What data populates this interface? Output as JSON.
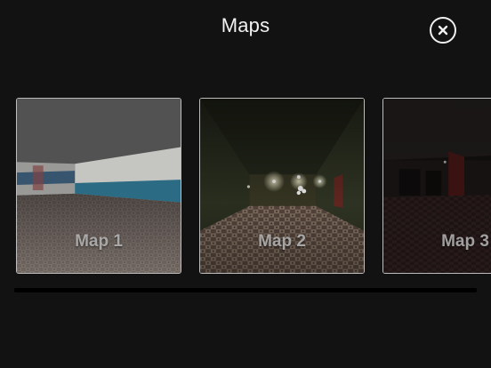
{
  "header": {
    "title": "Maps"
  },
  "close_button": {
    "icon": "close-icon"
  },
  "maps": [
    {
      "label": "Map 1"
    },
    {
      "label": "Map 2"
    },
    {
      "label": "Map 3"
    }
  ],
  "colors": {
    "background": "#121212",
    "title": "#f2f2f2",
    "card_border": "#bdbdbd"
  }
}
